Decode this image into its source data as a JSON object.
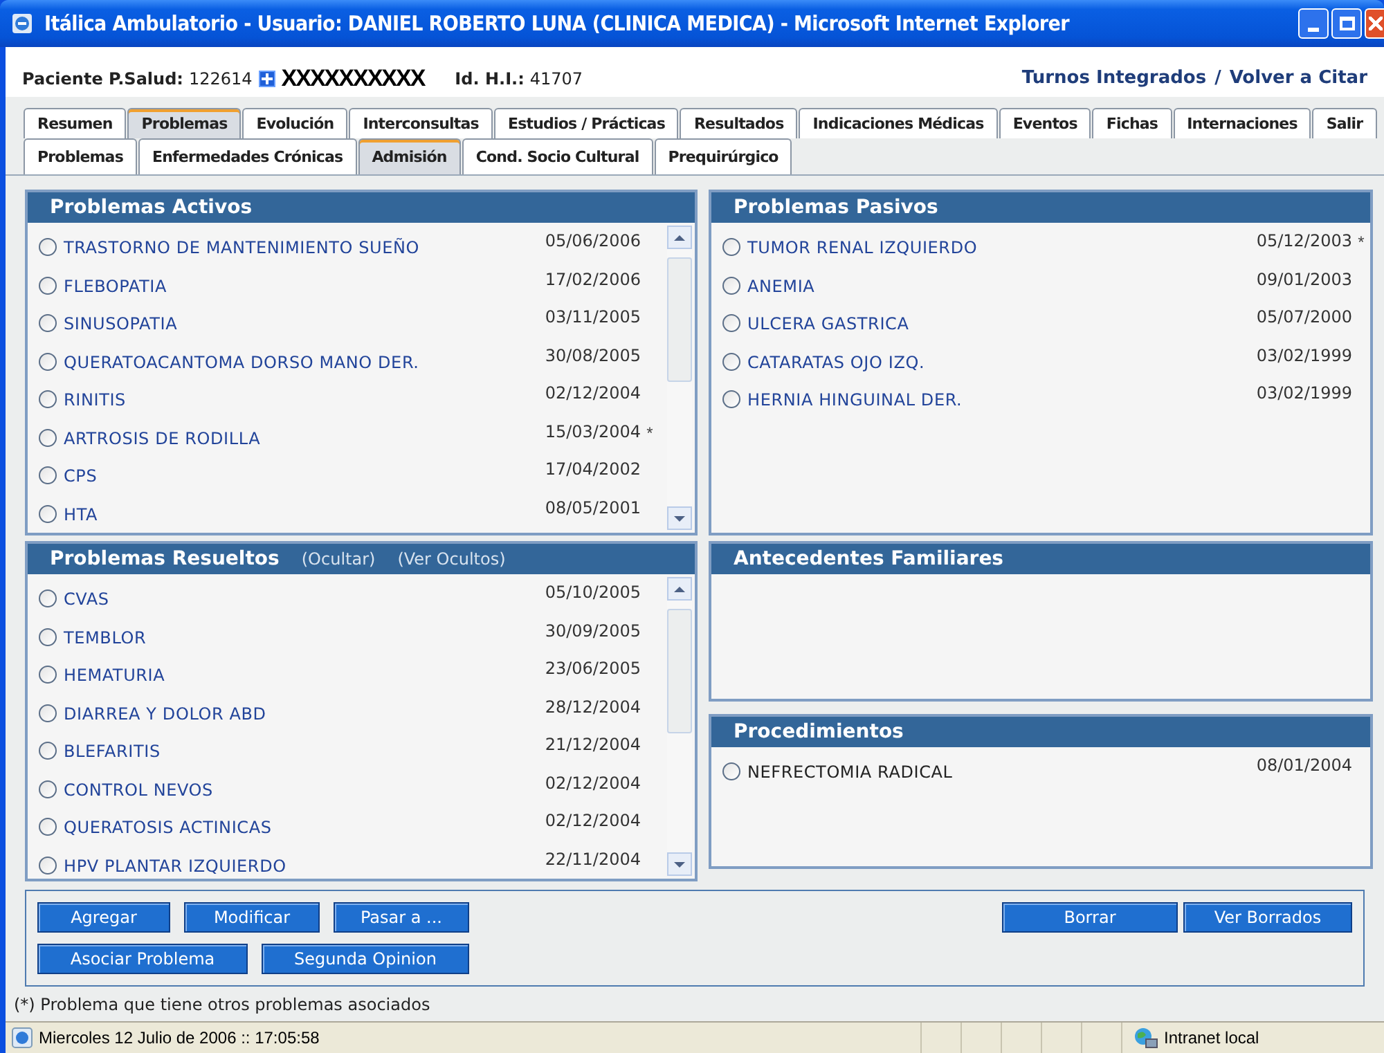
{
  "window": {
    "title": "Itálica Ambulatorio - Usuario: DANIEL ROBERTO LUNA (CLINICA MEDICA) - Microsoft Internet Explorer"
  },
  "patient": {
    "label": "Paciente P.Salud:",
    "number": "122614",
    "name": "XXXXXXXXXX",
    "hi_label": "Id. H.I.:",
    "hi_number": "41707"
  },
  "links": [
    "Turnos Integrados",
    "/",
    "Volver a Citar"
  ],
  "tabs": [
    {
      "label": "Resumen",
      "selected": false
    },
    {
      "label": "Problemas",
      "selected": true
    },
    {
      "label": "Evolución",
      "selected": false
    },
    {
      "label": "Interconsultas",
      "selected": false
    },
    {
      "label": "Estudios / Prácticas",
      "selected": false
    },
    {
      "label": "Resultados",
      "selected": false
    },
    {
      "label": "Indicaciones Médicas",
      "selected": false
    },
    {
      "label": "Eventos",
      "selected": false
    },
    {
      "label": "Fichas",
      "selected": false
    },
    {
      "label": "Internaciones",
      "selected": false
    },
    {
      "label": "Salir",
      "selected": false
    }
  ],
  "subtabs": [
    {
      "label": "Problemas",
      "selected": false
    },
    {
      "label": "Enfermedades Crónicas",
      "selected": false
    },
    {
      "label": "Admisión",
      "selected": true
    },
    {
      "label": "Cond.  Socio Cultural",
      "selected": false
    },
    {
      "label": "Prequirúrgico",
      "selected": false
    }
  ],
  "active_problems": {
    "title": "Problemas Activos",
    "scrollbar": true,
    "items": [
      {
        "name": "TRASTORNO DE MANTENIMIENTO SUEÑO",
        "date": "05/06/2006",
        "selected": false
      },
      {
        "name": "FLEBOPATIA",
        "date": "17/02/2006",
        "selected": false
      },
      {
        "name": "SINUSOPATIA",
        "date": "03/11/2005",
        "selected": false
      },
      {
        "name": "QUERATOACANTOMA DORSO MANO DER.",
        "date": "30/08/2005",
        "selected": false
      },
      {
        "name": "RINITIS",
        "date": "02/12/2004",
        "selected": false
      },
      {
        "name": "ARTROSIS DE RODILLA",
        "date": "15/03/2004",
        "mark": "*",
        "selected": false
      },
      {
        "name": "CPS",
        "date": "17/04/2002",
        "selected": false
      },
      {
        "name": "HTA",
        "date": "08/05/2001",
        "selected": false
      }
    ]
  },
  "passive_problems": {
    "title": "Problemas Pasivos",
    "scrollbar": false,
    "items": [
      {
        "name": "TUMOR RENAL IZQUIERDO",
        "date": "05/12/2003",
        "mark": "*",
        "selected": false
      },
      {
        "name": "ANEMIA",
        "date": "09/01/2003",
        "selected": false
      },
      {
        "name": "ULCERA GASTRICA",
        "date": "05/07/2000",
        "selected": false
      },
      {
        "name": "CATARATAS OJO IZQ.",
        "date": "03/02/1999",
        "selected": false
      },
      {
        "name": "HERNIA HINGUINAL DER.",
        "date": "03/02/1999",
        "selected": false
      }
    ]
  },
  "resolved_problems": {
    "title": "Problemas Resueltos",
    "actions": [
      "(Ocultar)",
      "(Ver Ocultos)"
    ],
    "scrollbar": true,
    "items": [
      {
        "name": "CVAS",
        "date": "05/10/2005",
        "selected": false
      },
      {
        "name": "TEMBLOR",
        "date": "30/09/2005",
        "selected": false
      },
      {
        "name": "HEMATURIA",
        "date": "23/06/2005",
        "selected": false
      },
      {
        "name": "DIARREA Y DOLOR ABD",
        "date": "28/12/2004",
        "selected": false
      },
      {
        "name": "BLEFARITIS",
        "date": "21/12/2004",
        "selected": false
      },
      {
        "name": "CONTROL NEVOS",
        "date": "02/12/2004",
        "selected": false
      },
      {
        "name": "QUERATOSIS ACTINICAS",
        "date": "02/12/2004",
        "selected": false
      },
      {
        "name": "HPV PLANTAR IZQUIERDO",
        "date": "22/11/2004",
        "selected": false
      }
    ]
  },
  "family_history": {
    "title": "Antecedentes Familiares",
    "scrollbar": false
  },
  "procedures": {
    "title": "Procedimientos",
    "scrollbar": false,
    "items": [
      {
        "name": "NEFRECTOMIA RADICAL",
        "date": "08/01/2004",
        "selected": false
      }
    ]
  },
  "buttons_left": [
    [
      "Agregar",
      "Modificar",
      "Pasar a ..."
    ],
    [
      "Asociar Problema",
      "Segunda Opinion"
    ]
  ],
  "buttons_right": [
    "Borrar",
    "Ver Borrados"
  ],
  "footnote": "(*) Problema que tiene otros problemas asociados",
  "status_bar": {
    "text": "Miercoles 12 Julio de 2006 :: 17:05:58",
    "zone": "Intranet local"
  }
}
